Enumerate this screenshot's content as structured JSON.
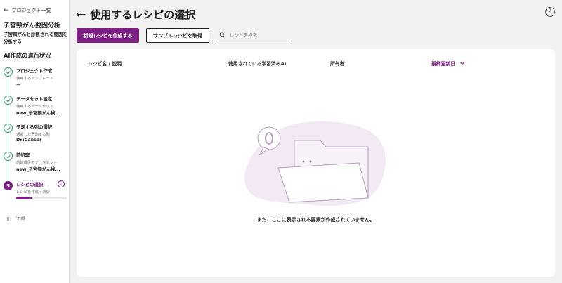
{
  "sidebar": {
    "back_label": "プロジェクト一覧",
    "project_title": "子宮頸がん要因分析",
    "project_desc": "子宮頸がんと診断される要因を分析する",
    "progress_title": "AI作成の進行状況",
    "steps": [
      {
        "title": "プロジェクト作成",
        "sub": "使用するテンプレート",
        "value": "ー"
      },
      {
        "title": "データセット設定",
        "sub": "使用するデータセット",
        "value": "new_子宮頸がん検..."
      },
      {
        "title": "予測する列の選択",
        "sub": "選択した予測する列",
        "value": "Dx:Cancer"
      },
      {
        "title": "前処理",
        "sub": "前処理後のデータセット",
        "value": "new_子宮頸がん検..."
      },
      {
        "number": "5",
        "title": "レシピの選択",
        "sub": "レシピを作成・選択",
        "progress": 0.3
      },
      {
        "number": "6",
        "title": "学習"
      }
    ]
  },
  "header": {
    "title": "使用するレシピの選択"
  },
  "toolbar": {
    "new_recipe_label": "新規レシピを作成する",
    "sample_recipe_label": "サンプルレシピを取得",
    "search_placeholder": "レシピを検索"
  },
  "table": {
    "columns": [
      "レシピ名 / 説明",
      "使用されている学習済みAI",
      "所有者",
      "最終更新日"
    ]
  },
  "empty_message": "まだ、ここに表示される要素が作成されていません。",
  "colors": {
    "accent": "#7b1f83",
    "complete": "#2f8f6e"
  }
}
